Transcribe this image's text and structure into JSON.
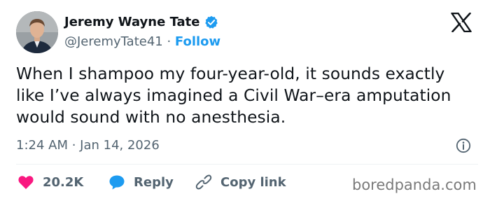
{
  "author": {
    "name": "Jeremy Wayne Tate",
    "handle": "@JeremyTate41",
    "separator": " · ",
    "follow_label": "Follow"
  },
  "tweet": {
    "text": "When I shampoo my four-year-old, it sounds exactly like I’ve always imagined a Civil War–era amputation would sound with no anesthesia.",
    "timestamp": "1:24 AM · Jan 14, 2026"
  },
  "actions": {
    "like_count": "20.2K",
    "reply_label": "Reply",
    "copy_link_label": "Copy link"
  },
  "watermark": "boredpanda.com",
  "icons": {
    "verified": "verified-badge-icon",
    "brand": "x-logo-icon",
    "info": "info-icon",
    "like": "heart-icon",
    "reply": "speech-bubble-icon",
    "copy": "link-icon"
  },
  "colors": {
    "accent": "#1d9bf0",
    "like": "#f91880",
    "text": "#0f1419",
    "secondary": "#536471"
  }
}
